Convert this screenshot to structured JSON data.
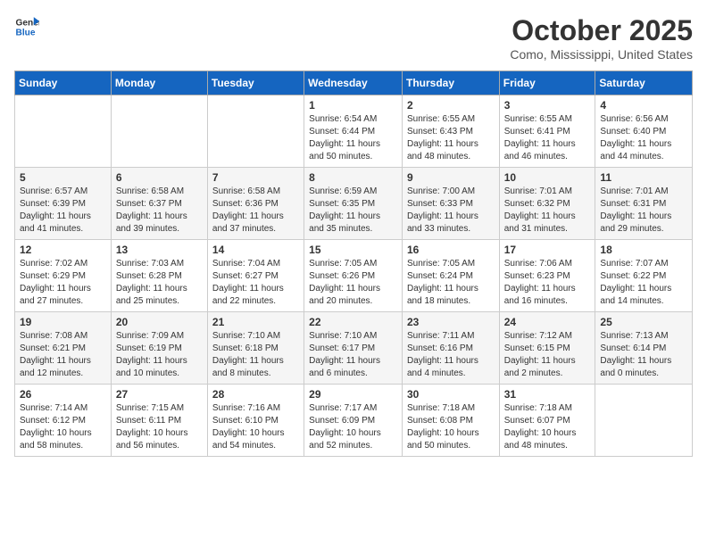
{
  "header": {
    "logo_general": "General",
    "logo_blue": "Blue",
    "month_title": "October 2025",
    "location": "Como, Mississippi, United States"
  },
  "weekdays": [
    "Sunday",
    "Monday",
    "Tuesday",
    "Wednesday",
    "Thursday",
    "Friday",
    "Saturday"
  ],
  "weeks": [
    [
      {
        "day": "",
        "info": ""
      },
      {
        "day": "",
        "info": ""
      },
      {
        "day": "",
        "info": ""
      },
      {
        "day": "1",
        "info": "Sunrise: 6:54 AM\nSunset: 6:44 PM\nDaylight: 11 hours\nand 50 minutes."
      },
      {
        "day": "2",
        "info": "Sunrise: 6:55 AM\nSunset: 6:43 PM\nDaylight: 11 hours\nand 48 minutes."
      },
      {
        "day": "3",
        "info": "Sunrise: 6:55 AM\nSunset: 6:41 PM\nDaylight: 11 hours\nand 46 minutes."
      },
      {
        "day": "4",
        "info": "Sunrise: 6:56 AM\nSunset: 6:40 PM\nDaylight: 11 hours\nand 44 minutes."
      }
    ],
    [
      {
        "day": "5",
        "info": "Sunrise: 6:57 AM\nSunset: 6:39 PM\nDaylight: 11 hours\nand 41 minutes."
      },
      {
        "day": "6",
        "info": "Sunrise: 6:58 AM\nSunset: 6:37 PM\nDaylight: 11 hours\nand 39 minutes."
      },
      {
        "day": "7",
        "info": "Sunrise: 6:58 AM\nSunset: 6:36 PM\nDaylight: 11 hours\nand 37 minutes."
      },
      {
        "day": "8",
        "info": "Sunrise: 6:59 AM\nSunset: 6:35 PM\nDaylight: 11 hours\nand 35 minutes."
      },
      {
        "day": "9",
        "info": "Sunrise: 7:00 AM\nSunset: 6:33 PM\nDaylight: 11 hours\nand 33 minutes."
      },
      {
        "day": "10",
        "info": "Sunrise: 7:01 AM\nSunset: 6:32 PM\nDaylight: 11 hours\nand 31 minutes."
      },
      {
        "day": "11",
        "info": "Sunrise: 7:01 AM\nSunset: 6:31 PM\nDaylight: 11 hours\nand 29 minutes."
      }
    ],
    [
      {
        "day": "12",
        "info": "Sunrise: 7:02 AM\nSunset: 6:29 PM\nDaylight: 11 hours\nand 27 minutes."
      },
      {
        "day": "13",
        "info": "Sunrise: 7:03 AM\nSunset: 6:28 PM\nDaylight: 11 hours\nand 25 minutes."
      },
      {
        "day": "14",
        "info": "Sunrise: 7:04 AM\nSunset: 6:27 PM\nDaylight: 11 hours\nand 22 minutes."
      },
      {
        "day": "15",
        "info": "Sunrise: 7:05 AM\nSunset: 6:26 PM\nDaylight: 11 hours\nand 20 minutes."
      },
      {
        "day": "16",
        "info": "Sunrise: 7:05 AM\nSunset: 6:24 PM\nDaylight: 11 hours\nand 18 minutes."
      },
      {
        "day": "17",
        "info": "Sunrise: 7:06 AM\nSunset: 6:23 PM\nDaylight: 11 hours\nand 16 minutes."
      },
      {
        "day": "18",
        "info": "Sunrise: 7:07 AM\nSunset: 6:22 PM\nDaylight: 11 hours\nand 14 minutes."
      }
    ],
    [
      {
        "day": "19",
        "info": "Sunrise: 7:08 AM\nSunset: 6:21 PM\nDaylight: 11 hours\nand 12 minutes."
      },
      {
        "day": "20",
        "info": "Sunrise: 7:09 AM\nSunset: 6:19 PM\nDaylight: 11 hours\nand 10 minutes."
      },
      {
        "day": "21",
        "info": "Sunrise: 7:10 AM\nSunset: 6:18 PM\nDaylight: 11 hours\nand 8 minutes."
      },
      {
        "day": "22",
        "info": "Sunrise: 7:10 AM\nSunset: 6:17 PM\nDaylight: 11 hours\nand 6 minutes."
      },
      {
        "day": "23",
        "info": "Sunrise: 7:11 AM\nSunset: 6:16 PM\nDaylight: 11 hours\nand 4 minutes."
      },
      {
        "day": "24",
        "info": "Sunrise: 7:12 AM\nSunset: 6:15 PM\nDaylight: 11 hours\nand 2 minutes."
      },
      {
        "day": "25",
        "info": "Sunrise: 7:13 AM\nSunset: 6:14 PM\nDaylight: 11 hours\nand 0 minutes."
      }
    ],
    [
      {
        "day": "26",
        "info": "Sunrise: 7:14 AM\nSunset: 6:12 PM\nDaylight: 10 hours\nand 58 minutes."
      },
      {
        "day": "27",
        "info": "Sunrise: 7:15 AM\nSunset: 6:11 PM\nDaylight: 10 hours\nand 56 minutes."
      },
      {
        "day": "28",
        "info": "Sunrise: 7:16 AM\nSunset: 6:10 PM\nDaylight: 10 hours\nand 54 minutes."
      },
      {
        "day": "29",
        "info": "Sunrise: 7:17 AM\nSunset: 6:09 PM\nDaylight: 10 hours\nand 52 minutes."
      },
      {
        "day": "30",
        "info": "Sunrise: 7:18 AM\nSunset: 6:08 PM\nDaylight: 10 hours\nand 50 minutes."
      },
      {
        "day": "31",
        "info": "Sunrise: 7:18 AM\nSunset: 6:07 PM\nDaylight: 10 hours\nand 48 minutes."
      },
      {
        "day": "",
        "info": ""
      }
    ]
  ]
}
